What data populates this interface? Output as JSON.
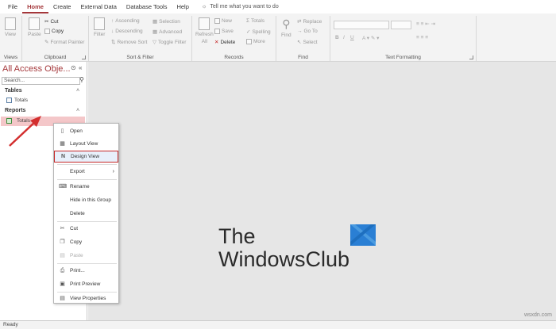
{
  "tabs": [
    "File",
    "Home",
    "Create",
    "External Data",
    "Database Tools",
    "Help"
  ],
  "active_tab": "Home",
  "tell_me": "Tell me what you want to do",
  "ribbon": {
    "views": {
      "label": "Views",
      "view_btn": "View"
    },
    "clipboard": {
      "label": "Clipboard",
      "paste": "Paste",
      "cut": "Cut",
      "copy": "Copy",
      "format_painter": "Format Painter"
    },
    "sort_filter": {
      "label": "Sort & Filter",
      "filter": "Filter",
      "ascending": "Ascending",
      "descending": "Descending",
      "remove_sort": "Remove Sort",
      "selection": "Selection",
      "advanced": "Advanced",
      "toggle_filter": "Toggle Filter"
    },
    "records": {
      "label": "Records",
      "refresh": "Refresh",
      "refresh_all": "All",
      "new": "New",
      "save": "Save",
      "delete": "Delete",
      "totals": "Totals",
      "spelling": "Spelling",
      "more": "More"
    },
    "find": {
      "label": "Find",
      "find": "Find",
      "replace": "Replace",
      "go_to": "Go To",
      "select": "Select"
    },
    "text_formatting": {
      "label": "Text Formatting"
    }
  },
  "nav": {
    "title": "All Access Obje...",
    "search_placeholder": "Search...",
    "sections": [
      {
        "name": "Tables",
        "items": [
          "Totals"
        ]
      },
      {
        "name": "Reports",
        "items": [
          "Totals"
        ]
      }
    ]
  },
  "context_menu": [
    {
      "label": "Open",
      "icon": "open-icon"
    },
    {
      "label": "Layout View",
      "icon": "layout-view-icon"
    },
    {
      "label": "Design View",
      "icon": "design-view-icon",
      "highlighted": true
    },
    {
      "label": "Export",
      "icon": "",
      "submenu": true
    },
    {
      "label": "Rename",
      "icon": "rename-icon"
    },
    {
      "label": "Hide in this Group",
      "icon": ""
    },
    {
      "label": "Delete",
      "icon": ""
    },
    {
      "label": "Cut",
      "icon": "cut-icon"
    },
    {
      "label": "Copy",
      "icon": "copy-icon"
    },
    {
      "label": "Paste",
      "icon": "paste-icon",
      "disabled": true
    },
    {
      "label": "Print...",
      "icon": "print-icon"
    },
    {
      "label": "Print Preview",
      "icon": "print-preview-icon"
    },
    {
      "label": "View Properties",
      "icon": "properties-icon"
    }
  ],
  "status": "Ready",
  "logo": {
    "line1": "The",
    "line2": "WindowsClub"
  },
  "watermark": "wsxdn.com",
  "colors": {
    "accent": "#a4373a",
    "highlight_border": "#c62828",
    "arrow": "#d32f2f",
    "logo_blue": "#2a7fd4"
  }
}
